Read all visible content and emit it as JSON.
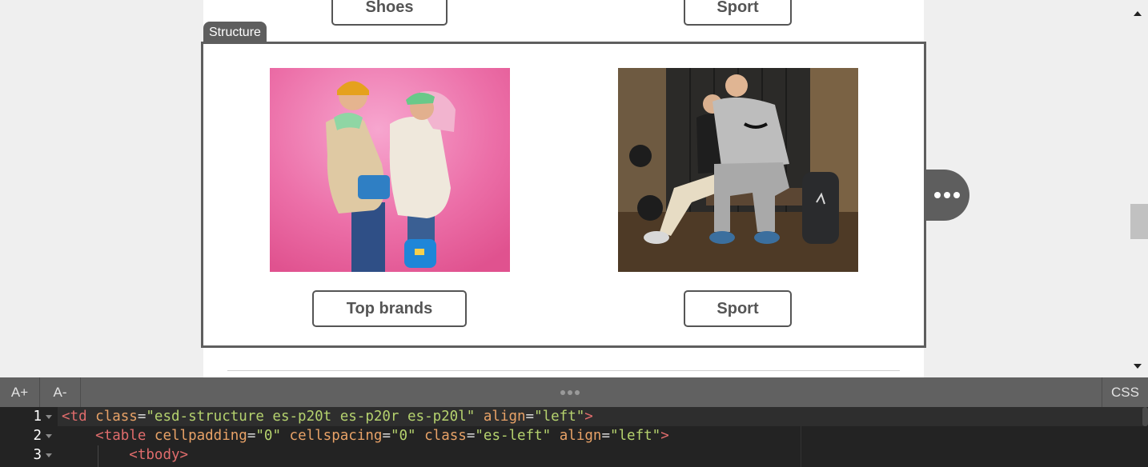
{
  "email": {
    "top_buttons": {
      "left": "Shoes",
      "right": "Sport"
    },
    "structure_label": "Structure",
    "bottom_buttons": {
      "left": "Top brands",
      "right": "Sport"
    }
  },
  "code_toolbar": {
    "font_increase": "A+",
    "font_decrease": "A-",
    "css_toggle": "CSS"
  },
  "code_panel": {
    "line_numbers": [
      "1",
      "2",
      "3"
    ],
    "lines": [
      {
        "tag_open": "<td",
        "a1": "class",
        "v1": "\"esd-structure es-p20t es-p20r es-p20l\"",
        "a2": "align",
        "v2": "\"left\"",
        "tag_close": ">"
      },
      {
        "tag_open": "<table",
        "a1": "cellpadding",
        "v1": "\"0\"",
        "a2": "cellspacing",
        "v2": "\"0\"",
        "a3": "class",
        "v3": "\"es-left\"",
        "a4": "align",
        "v4": "\"left\"",
        "tag_close": ">"
      },
      {
        "tag": "<tbody>"
      }
    ]
  },
  "colors": {
    "structure_accent": "#5e5e5e",
    "button_border": "#555555",
    "code_bg": "#232323",
    "tag": "#e06c6c",
    "attribute": "#e8a267",
    "string": "#b5d26e"
  },
  "icons": [
    "more-options-icon",
    "scroll-up-arrow-icon",
    "scroll-down-arrow-icon",
    "drag-handle-icon"
  ]
}
